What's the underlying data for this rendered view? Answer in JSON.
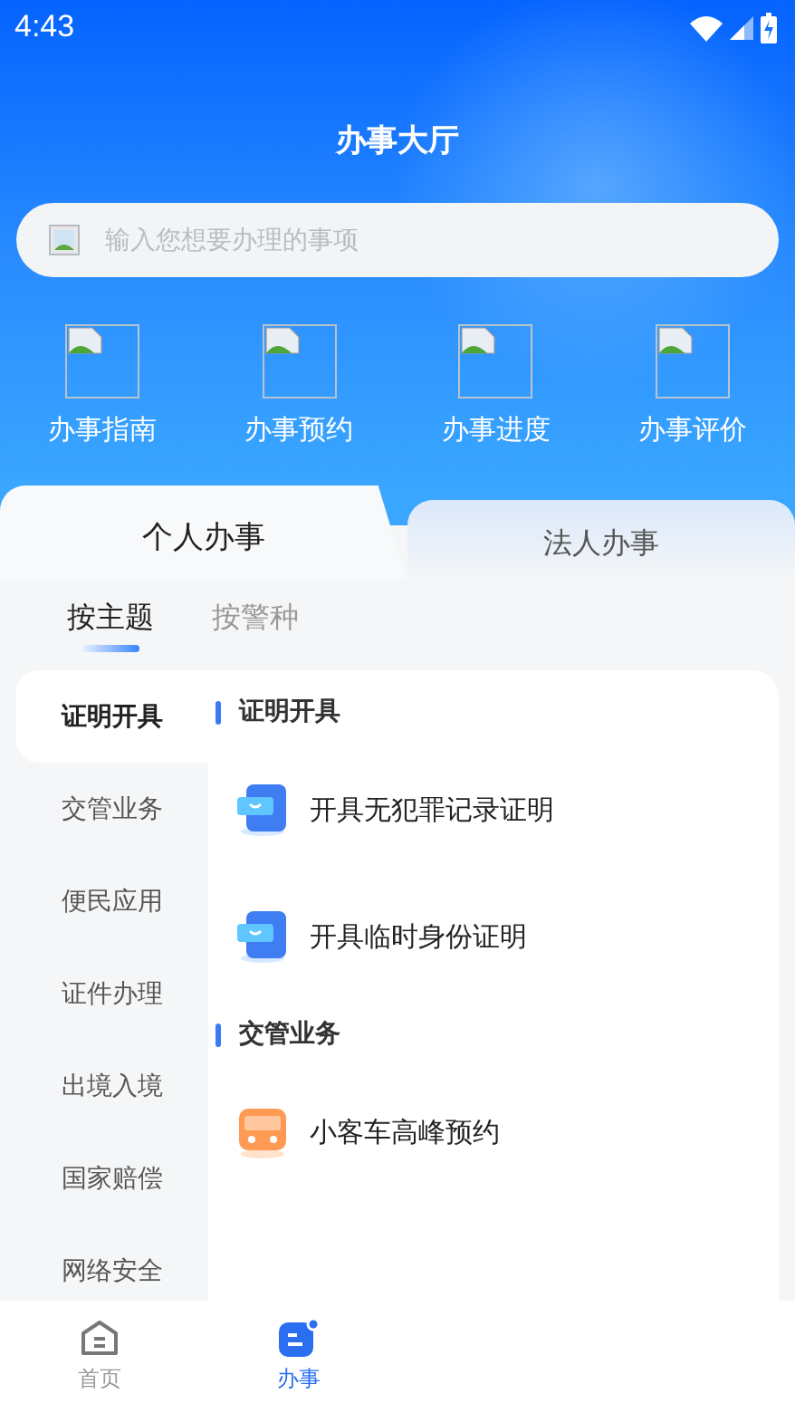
{
  "status_bar": {
    "time": "4:43"
  },
  "header": {
    "title": "办事大厅"
  },
  "search": {
    "placeholder": "输入您想要办理的事项"
  },
  "quick_actions": [
    {
      "label": "办事指南"
    },
    {
      "label": "办事预约"
    },
    {
      "label": "办事进度"
    },
    {
      "label": "办事评价"
    }
  ],
  "tabs": [
    {
      "label": "个人办事",
      "selected": true
    },
    {
      "label": "法人办事",
      "selected": false
    }
  ],
  "sub_tabs": [
    {
      "label": "按主题",
      "selected": true
    },
    {
      "label": "按警种",
      "selected": false
    }
  ],
  "categories": [
    {
      "label": "证明开具",
      "selected": true
    },
    {
      "label": "交管业务",
      "selected": false
    },
    {
      "label": "便民应用",
      "selected": false
    },
    {
      "label": "证件办理",
      "selected": false
    },
    {
      "label": "出境入境",
      "selected": false
    },
    {
      "label": "国家赔偿",
      "selected": false
    },
    {
      "label": "网络安全",
      "selected": false
    }
  ],
  "sections": [
    {
      "title": "证明开具",
      "items": [
        {
          "label": "开具无犯罪记录证明",
          "kind": "document"
        },
        {
          "label": "开具临时身份证明",
          "kind": "document"
        }
      ]
    },
    {
      "title": "交管业务",
      "items": [
        {
          "label": "小客车高峰预约",
          "kind": "bus"
        }
      ]
    }
  ],
  "bottom_nav": [
    {
      "label": "首页",
      "kind": "home",
      "selected": false
    },
    {
      "label": "办事",
      "kind": "service",
      "selected": true
    }
  ]
}
